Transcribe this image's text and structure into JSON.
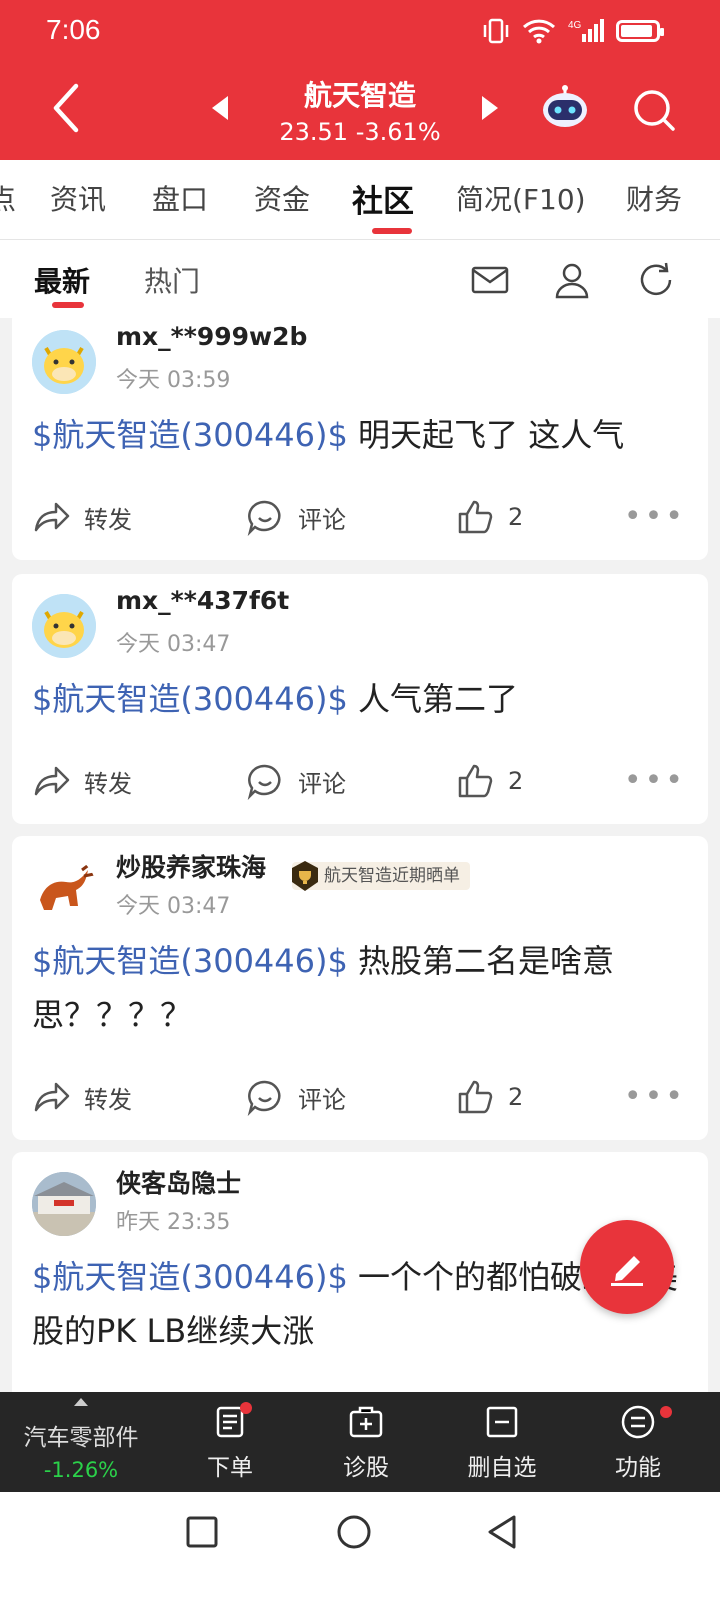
{
  "status_bar": {
    "time": "7:06",
    "network": "4G"
  },
  "header": {
    "stock_name": "航天智造",
    "price": "23.51",
    "change_pct": "-3.61%"
  },
  "tabs": [
    {
      "label": "资讯",
      "active": false
    },
    {
      "label": "盘口",
      "active": false
    },
    {
      "label": "资金",
      "active": false
    },
    {
      "label": "社区",
      "active": true
    },
    {
      "label": "简况(F10)",
      "active": false
    },
    {
      "label": "财务",
      "active": false
    }
  ],
  "tab_partial_left": "点",
  "subtabs": [
    {
      "label": "最新",
      "active": true
    },
    {
      "label": "热门",
      "active": false
    }
  ],
  "posts": [
    {
      "user": "mx_**999w2b",
      "time": "今天 03:59",
      "stock_tag": "$航天智造(300446)$",
      "text": " 明天起飞了 这人气",
      "share": "转发",
      "comment": "评论",
      "likes": "2"
    },
    {
      "user": "mx_**437f6t",
      "time": "今天 03:47",
      "stock_tag": "$航天智造(300446)$",
      "text": " 人气第二了",
      "share": "转发",
      "comment": "评论",
      "likes": "2"
    },
    {
      "user": "炒股养家珠海",
      "badge": "航天智造近期晒单",
      "time": "今天 03:47",
      "stock_tag": "$航天智造(300446)$",
      "text": " 热股第二名是啥意思？？？？",
      "share": "转发",
      "comment": "评论",
      "likes": "2"
    },
    {
      "user": "侠客岛隐士",
      "time": "昨天 23:35",
      "stock_tag": "$航天智造(300446)$",
      "text": " 一个个的都怕破线，美股的PK LB继续大涨"
    }
  ],
  "bottom_bar": {
    "sector_name": "汽车零部件",
    "sector_change": "-1.26%",
    "items": [
      {
        "label": "下单",
        "icon": "order-icon"
      },
      {
        "label": "诊股",
        "icon": "diagnose-icon"
      },
      {
        "label": "删自选",
        "icon": "remove-watchlist-icon"
      },
      {
        "label": "功能",
        "icon": "menu-icon"
      }
    ]
  },
  "colors": {
    "brand_red": "#e8343b",
    "link_blue": "#3e63b3",
    "up_green": "#2bd14a"
  },
  "battery_level": 0.9
}
